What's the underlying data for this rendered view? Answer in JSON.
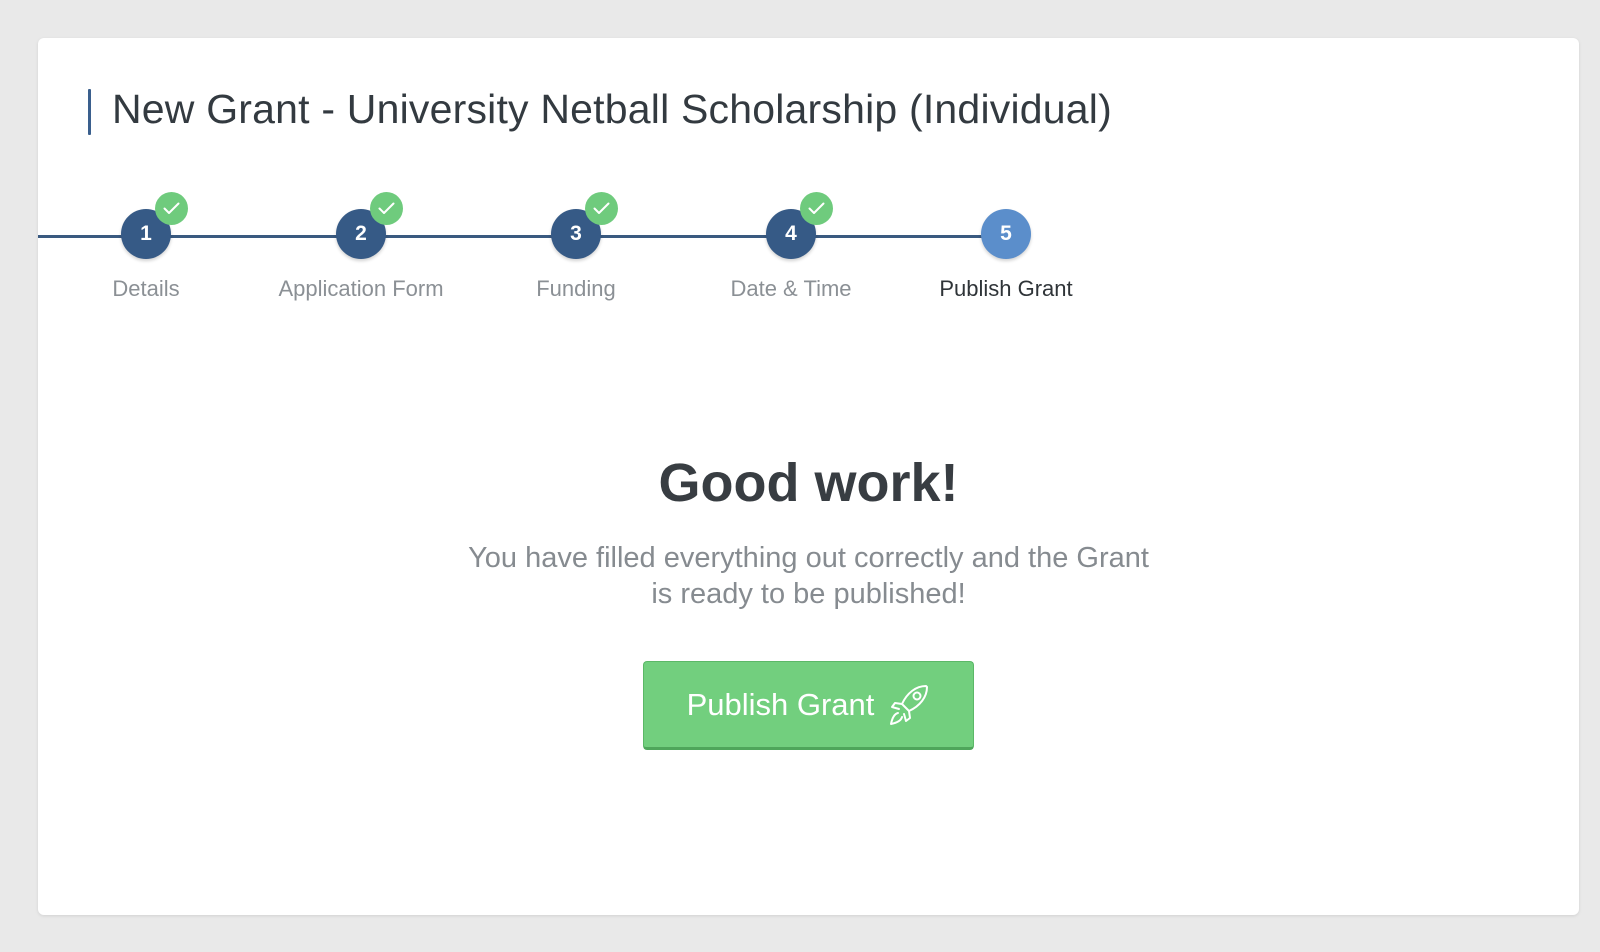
{
  "page": {
    "title": "New Grant - University Netball Scholarship (Individual)"
  },
  "stepper": {
    "steps": [
      {
        "number": "1",
        "label": "Details",
        "state": "completed"
      },
      {
        "number": "2",
        "label": "Application Form",
        "state": "completed"
      },
      {
        "number": "3",
        "label": "Funding",
        "state": "completed"
      },
      {
        "number": "4",
        "label": "Date & Time",
        "state": "completed"
      },
      {
        "number": "5",
        "label": "Publish Grant",
        "state": "active"
      }
    ]
  },
  "main": {
    "headline": "Good work!",
    "message": "You have filled everything out correctly and the Grant is ready to be published!",
    "publish_button_label": "Publish Grant",
    "publish_button_icon": "rocket-icon"
  },
  "colors": {
    "completed_step": "#365a86",
    "active_step": "#5b8ecb",
    "check_badge": "#6fcb7d",
    "publish_button": "#72cf7e"
  }
}
